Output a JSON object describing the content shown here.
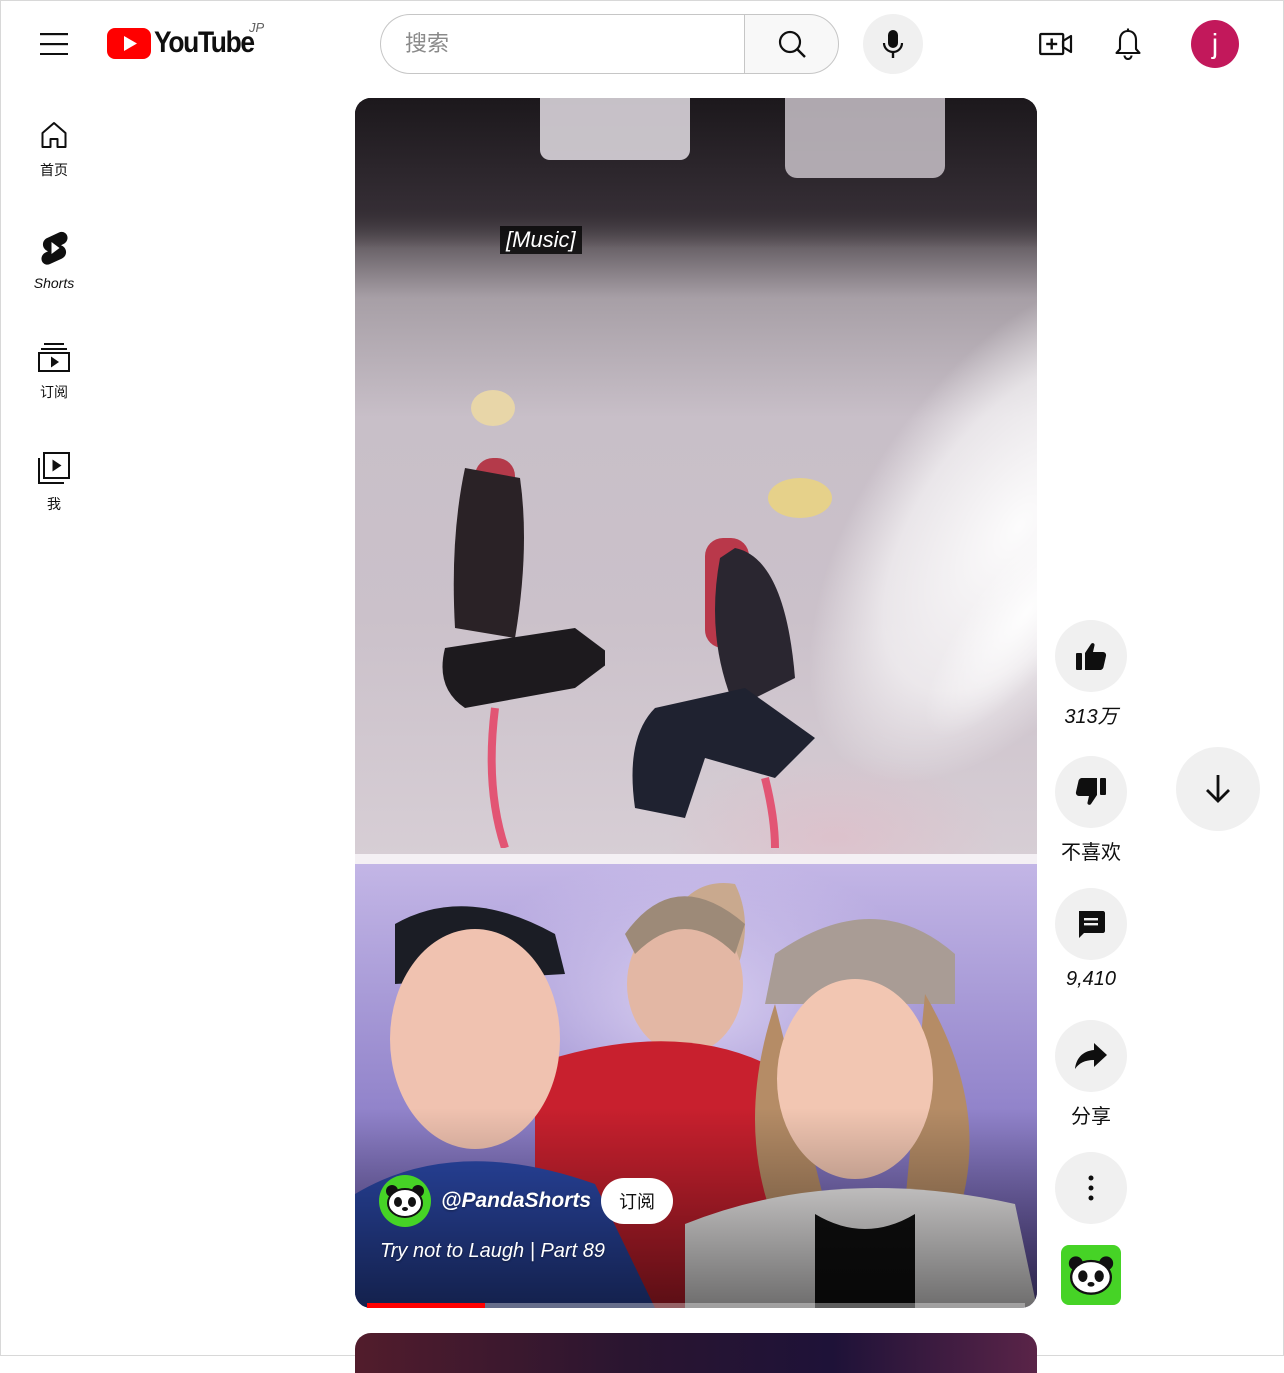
{
  "header": {
    "logo_text": "YouTube",
    "region_code": "JP",
    "search_placeholder": "搜索",
    "avatar_letter": "j",
    "avatar_color": "#c2185b"
  },
  "sidebar": {
    "items": [
      {
        "label": "首页",
        "icon": "home-icon"
      },
      {
        "label": "Shorts",
        "icon": "shorts-icon"
      },
      {
        "label": "订阅",
        "icon": "subscriptions-icon"
      },
      {
        "label": "我",
        "icon": "you-icon"
      }
    ]
  },
  "short": {
    "caption": "[Music]",
    "channel_handle": "@PandaShorts",
    "subscribe_label": "订阅",
    "title": "Try not to Laugh | Part 89",
    "progress_fraction": 0.18
  },
  "actions": {
    "like_count": "313万",
    "dislike_label": "不喜欢",
    "comment_count": "9,410",
    "share_label": "分享"
  },
  "colors": {
    "brand_red": "#ff0000",
    "channel_green": "#46d326",
    "button_bg": "#f0f0f0"
  }
}
